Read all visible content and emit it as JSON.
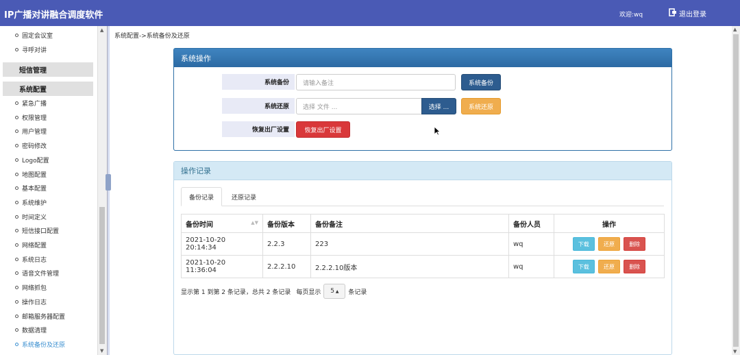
{
  "header": {
    "app_title": "IP广播对讲融合调度软件",
    "welcome": "欢迎:wq",
    "logout_label": "退出登录"
  },
  "sidebar": {
    "top_items": [
      "固定会议室",
      "寻呼对讲"
    ],
    "group_sms": "短信管理",
    "group_config": "系统配置",
    "config_items": [
      "紧急广播",
      "权限管理",
      "用户管理",
      "密码修改",
      "Logo配置",
      "地图配置",
      "基本配置",
      "系统维护",
      "时间定义",
      "短信接口配置",
      "网络配置",
      "系统日志",
      "语音文件管理",
      "网络抓包",
      "操作日志",
      "邮箱服务器配置",
      "数据清理",
      "系统备份及还原"
    ],
    "active_index": 17
  },
  "breadcrumb": "系统配置->系统备份及还原",
  "ops_panel": {
    "title": "系统操作",
    "backup_label": "系统备份",
    "backup_placeholder": "请输入备注",
    "backup_button": "系统备份",
    "restore_label": "系统还原",
    "restore_file_placeholder": "选择 文件 ...",
    "choose_button": "选择 ...",
    "restore_button": "系统还原",
    "factory_label": "恢复出厂设置",
    "factory_button": "恢复出厂设置"
  },
  "log_panel": {
    "title": "操作记录",
    "tabs": [
      "备份记录",
      "还原记录"
    ],
    "active_tab": 0,
    "columns": [
      "备份时间",
      "备份版本",
      "备份备注",
      "备份人员",
      "操作"
    ],
    "rows": [
      {
        "time": "2021-10-20 20:14:34",
        "version": "2.2.3",
        "note": "223",
        "user": "wq"
      },
      {
        "time": "2021-10-20 11:36:04",
        "version": "2.2.2.10",
        "note": "2.2.2.10版本",
        "user": "wq"
      }
    ],
    "actions": {
      "download": "下载",
      "restore": "还原",
      "delete": "删除"
    },
    "pager": {
      "summary": "显示第 1 到第 2 条记录，总共 2 条记录",
      "per_page_prefix": "每页显示",
      "page_size": "5",
      "per_page_suffix": "条记录"
    }
  },
  "colors": {
    "header_bg": "#4a5ab5",
    "navy_button": "#2d5c8f",
    "orange_button": "#f0ad4e",
    "red_button": "#d9383a",
    "info_button": "#5bc0de",
    "active_link": "#3a8fd0"
  }
}
